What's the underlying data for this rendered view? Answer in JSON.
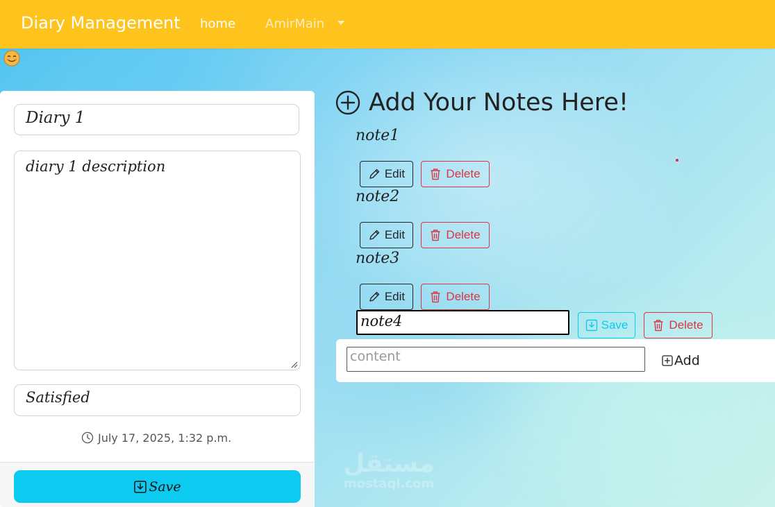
{
  "navbar": {
    "brand": "Diary Management",
    "home": "home",
    "user": "AmirMain"
  },
  "diary": {
    "title": "Diary 1",
    "description": "diary 1 description",
    "mood": "Satisfied",
    "date": "July 17, 2025, 1:32 p.m.",
    "save_label": "Save"
  },
  "notes": {
    "heading": "Add Your Notes Here!",
    "items": [
      {
        "label": "note1",
        "edit_label": "Edit",
        "delete_label": "Delete"
      },
      {
        "label": "note2",
        "edit_label": "Edit",
        "delete_label": "Delete"
      },
      {
        "label": "note3",
        "edit_label": "Edit",
        "delete_label": "Delete"
      }
    ],
    "editing": {
      "value": "note4",
      "save_label": "Save",
      "delete_label": "Delete"
    },
    "add": {
      "placeholder": "content",
      "add_label": "Add"
    }
  },
  "watermark": {
    "arabic": "مستقل",
    "latin": "mostaql.com"
  },
  "colors": {
    "navbar": "#fec31d",
    "primary_info": "#0dcaf0",
    "danger": "#dc3545",
    "dark": "#212529"
  }
}
